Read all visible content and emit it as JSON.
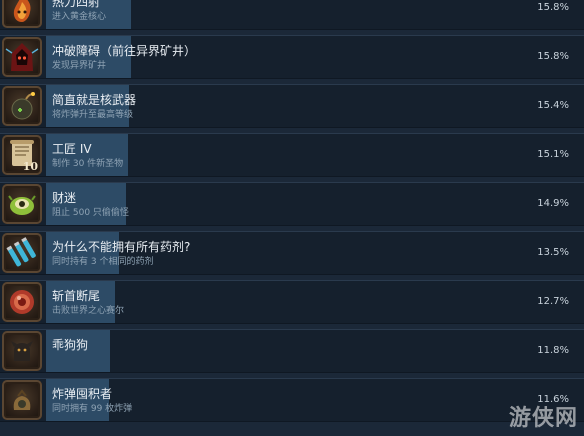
{
  "achievements": [
    {
      "title": "热力四射",
      "description": "进入黄金核心",
      "percent": "15.8%",
      "icon": "fire-creature-icon"
    },
    {
      "title": "冲破障碍（前往异界矿井）",
      "description": "发现异界矿井",
      "percent": "15.8%",
      "icon": "hooded-figure-icon"
    },
    {
      "title": "简直就是核武器",
      "description": "将炸弹升至最高等级",
      "percent": "15.4%",
      "icon": "bomb-icon"
    },
    {
      "title": "工匠 IV",
      "description": "制作 30 件新圣物",
      "percent": "15.1%",
      "icon": "scroll-icon",
      "badge": "10"
    },
    {
      "title": "财迷",
      "description": "阻止 500 只偷偷怪",
      "percent": "14.9%",
      "icon": "green-pilfer-icon"
    },
    {
      "title": "为什么不能拥有所有药剂?",
      "description": "同时持有 3 个相同的药剂",
      "percent": "13.5%",
      "icon": "potion-vials-icon"
    },
    {
      "title": "斩首断尾",
      "description": "击败世界之心赛尔",
      "percent": "12.7%",
      "icon": "red-orb-icon"
    },
    {
      "title": "乖狗狗",
      "description": "",
      "percent": "11.8%",
      "icon": "dog-icon"
    },
    {
      "title": "炸弹囤积者",
      "description": "同时拥有 99 枚炸弹",
      "percent": "11.6%",
      "icon": "bomb-sack-icon"
    }
  ],
  "fill_percent": [
    15.8,
    15.8,
    15.4,
    15.1,
    14.9,
    13.5,
    12.7,
    11.8,
    11.6
  ],
  "watermark": "游侠网"
}
